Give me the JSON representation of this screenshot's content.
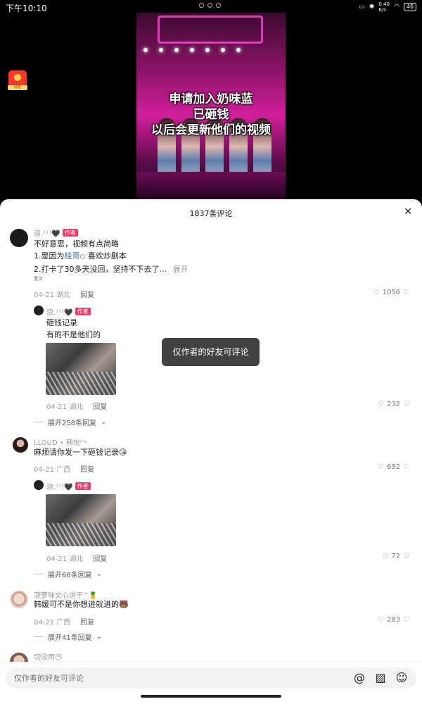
{
  "status": {
    "time": "下午10:10",
    "net_speed": "0.40\nK/s",
    "battery": "46"
  },
  "video": {
    "caption_lines": [
      "申请加入奶味蓝",
      "已砸钱",
      "以后会更新他们的视频"
    ]
  },
  "badge": {
    "label": "红包"
  },
  "sheet": {
    "title": "1837条评论"
  },
  "comments": {
    "c1": {
      "name": "浪.¹¹¹🖤",
      "tag": "作者",
      "line1": "不好意思，视频有点简略",
      "line2_pre": "1.是因为",
      "line2_link": "桂哥",
      "line2_post": "喜欢炒剧本",
      "line3": "2.打卡了30多天没回，坚持不下去了…",
      "expand": "展开",
      "tiny": "置顶",
      "date": "04-21 湖北",
      "reply": "回复",
      "likes": "1056"
    },
    "r1": {
      "name": "浪.¹¹¹🖤",
      "tag": "作者",
      "line1": "砸钱记录",
      "line2": "有的不是他们的",
      "date": "04-21 湖北",
      "reply": "回复",
      "likes": "232",
      "more": "展开258条回复"
    },
    "c2": {
      "name": "LLOUD • 韩怡ᵐᵞ",
      "text": "麻烦请你发一下砸钱记录😘",
      "date": "04-21 广西",
      "reply": "回复",
      "likes": "692"
    },
    "r2": {
      "name": "浪.¹¹¹🖤",
      "tag": "作者",
      "date": "04-21 湖北",
      "reply": "回复",
      "likes": "72",
      "more": "展开68条回复"
    },
    "c3": {
      "name": "菠萝味文心饼干^🍍",
      "text": "韩媛可不是你想进就进的🐻",
      "date": "04-21 广西",
      "reply": "回复",
      "likes": "283",
      "more": "展开41条回复"
    },
    "c4": {
      "name": "切没用😶"
    }
  },
  "toast": "仅作者的好友可评论",
  "input": {
    "placeholder": "仅作者的好友可评论"
  }
}
